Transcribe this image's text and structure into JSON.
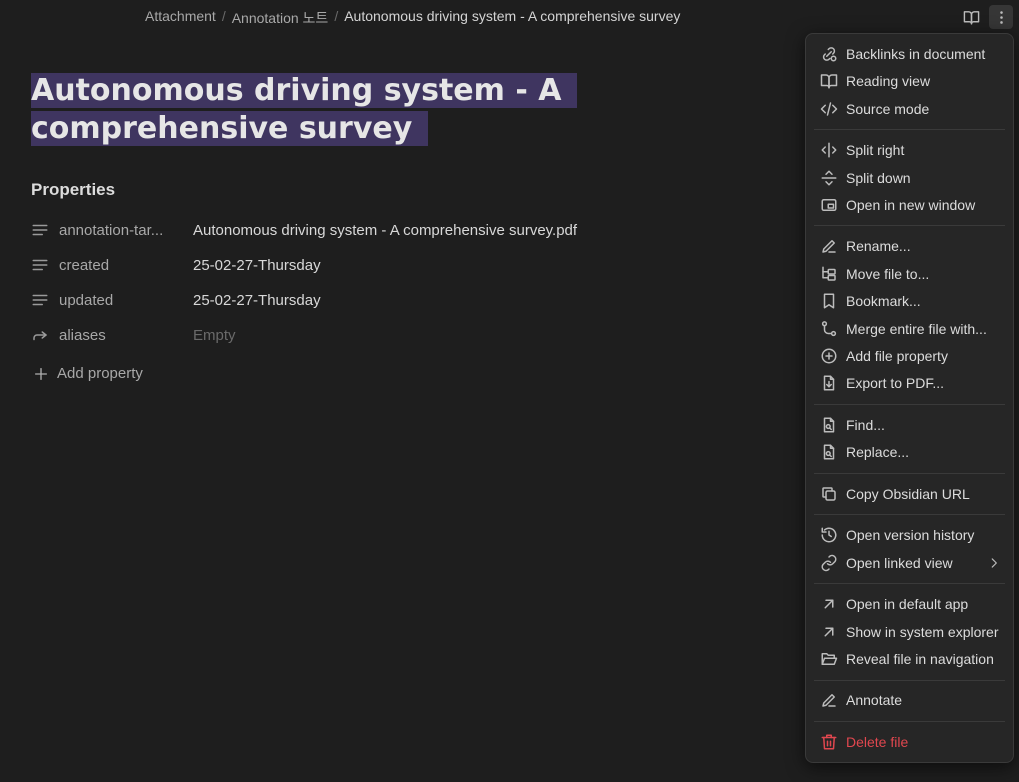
{
  "breadcrumb": {
    "items": [
      "Attachment",
      "Annotation 노트",
      "Autonomous driving system - A comprehensive survey"
    ],
    "separator": "/"
  },
  "header": {
    "reading_icon": "book-open-icon",
    "more_icon": "more-vertical-icon"
  },
  "title": "Autonomous driving system - A comprehensive survey",
  "properties": {
    "heading": "Properties",
    "items": [
      {
        "icon": "text-lines-icon",
        "key": "annotation-tar...",
        "value": "Autonomous driving system - A comprehensive survey.pdf"
      },
      {
        "icon": "text-lines-icon",
        "key": "created",
        "value": "25-02-27-Thursday"
      },
      {
        "icon": "text-lines-icon",
        "key": "updated",
        "value": "25-02-27-Thursday"
      },
      {
        "icon": "forward-arrow-icon",
        "key": "aliases",
        "value": "Empty"
      }
    ],
    "add_label": "Add property"
  },
  "menu": {
    "items": [
      {
        "label": "Backlinks in document",
        "icon": "backlinks-icon"
      },
      {
        "label": "Reading view",
        "icon": "book-open-icon"
      },
      {
        "label": "Source mode",
        "icon": "code-icon"
      },
      {
        "label": "Split right",
        "icon": "split-right-icon"
      },
      {
        "label": "Split down",
        "icon": "split-down-icon"
      },
      {
        "label": "Open in new window",
        "icon": "new-window-icon"
      },
      {
        "label": "Rename...",
        "icon": "pencil-icon"
      },
      {
        "label": "Move file to...",
        "icon": "folder-tree-icon"
      },
      {
        "label": "Bookmark...",
        "icon": "bookmark-icon"
      },
      {
        "label": "Merge entire file with...",
        "icon": "git-merge-icon"
      },
      {
        "label": "Add file property",
        "icon": "plus-circle-icon"
      },
      {
        "label": "Export to PDF...",
        "icon": "file-download-icon"
      },
      {
        "label": "Find...",
        "icon": "file-search-icon"
      },
      {
        "label": "Replace...",
        "icon": "file-search-icon"
      },
      {
        "label": "Copy Obsidian URL",
        "icon": "copy-icon"
      },
      {
        "label": "Open version history",
        "icon": "history-icon"
      },
      {
        "label": "Open linked view",
        "icon": "link-icon"
      },
      {
        "label": "Open in default app",
        "icon": "arrow-up-right-icon"
      },
      {
        "label": "Show in system explorer",
        "icon": "arrow-up-right-icon"
      },
      {
        "label": "Reveal file in navigation",
        "icon": "folder-open-icon"
      },
      {
        "label": "Annotate",
        "icon": "pencil-icon"
      },
      {
        "label": "Delete file",
        "icon": "trash-icon"
      }
    ],
    "danger_color": "#e0474f"
  },
  "colors": {
    "background": "#1e1e1e",
    "title_highlight": "#3f3560",
    "menu_bg": "#262626"
  }
}
